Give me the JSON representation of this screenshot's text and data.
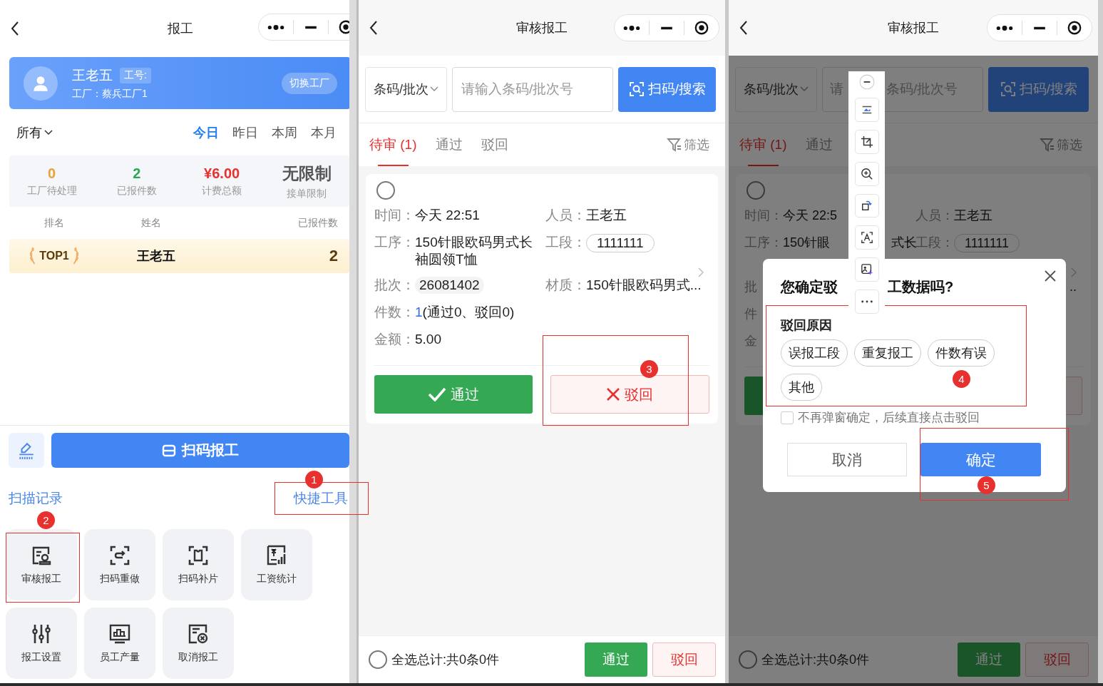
{
  "screen_report": {
    "nav": {
      "title": "报工"
    },
    "user": {
      "name": "王老五",
      "id_label": "工号:",
      "factory": "工厂：蔡兵工厂1",
      "switch_button": "切换工厂"
    },
    "scope_dropdown": "所有",
    "periods": [
      {
        "label": "今日",
        "selected": true
      },
      {
        "label": "昨日",
        "selected": false
      },
      {
        "label": "本周",
        "selected": false
      },
      {
        "label": "本月",
        "selected": false
      }
    ],
    "stats": [
      {
        "value": "0",
        "label": "工厂待处理",
        "color": "#e8a23a"
      },
      {
        "value": "2",
        "label": "已报件数",
        "color": "#2ea54f"
      },
      {
        "value": "¥6.00",
        "label": "计费总额",
        "color": "#e8302f"
      },
      {
        "value": "无限制",
        "label": "接单限制",
        "color": "#555555"
      }
    ],
    "ranking": {
      "columns": [
        "排名",
        "姓名",
        "已报件数"
      ],
      "rows": [
        {
          "rank": "TOP1",
          "name": "王老五",
          "count": "2"
        }
      ]
    },
    "scan_button": "扫码报工",
    "records_link": "扫描记录",
    "tools_link": "快捷工具",
    "tools": [
      {
        "kind": "review",
        "label": "审核报工"
      },
      {
        "kind": "redo",
        "label": "扫码重做"
      },
      {
        "kind": "patch",
        "label": "扫码补片"
      },
      {
        "kind": "salary",
        "label": "工资统计"
      },
      {
        "kind": "settings",
        "label": "报工设置"
      },
      {
        "kind": "output",
        "label": "员工产量"
      },
      {
        "kind": "cancel",
        "label": "取消报工"
      }
    ]
  },
  "screen_review": {
    "nav": {
      "title": "审核报工"
    },
    "search": {
      "mode": "条码/批次",
      "placeholder": "请输入条码/批次号",
      "button": "扫码/搜索"
    },
    "tabs": [
      {
        "label": "待审 (1)",
        "selected": true
      },
      {
        "label": "通过",
        "selected": false
      },
      {
        "label": "驳回",
        "selected": false
      }
    ],
    "filter": "筛选",
    "record": {
      "selected": false,
      "time_label": "时间：",
      "time": "今天 22:51",
      "person_label": "人员：",
      "person": "王老五",
      "process_label": "工序：",
      "process": "150针眼欧码男式长袖圆领T恤",
      "section_label": "工段：",
      "section": "1111111",
      "batch_label": "批次：",
      "batch": "26081402",
      "material_label": "材质：",
      "material": "150针眼欧码男式...",
      "count_label": "件数：",
      "count": "1",
      "count_detail": "(通过0、驳回0)",
      "amount_label": "金额：",
      "amount": "5.00",
      "pass_button": "通过",
      "reject_button": "驳回"
    },
    "footer": {
      "checked": false,
      "select_all": "全选总计:共0条0件",
      "pass_button": "通过",
      "reject_button": "驳回"
    }
  },
  "screen_reject": {
    "nav": {
      "title": "审核报工"
    },
    "search": {
      "mode": "条码/批次",
      "placeholder_parts": [
        "请",
        "条码/批次号"
      ],
      "button": "扫码/搜索"
    },
    "tabs": [
      {
        "label": "待审 (1)",
        "selected": true
      },
      {
        "label": "通过",
        "selected": false
      }
    ],
    "filter": "筛选",
    "record": {
      "selected": false,
      "time_label": "时间：",
      "time": "今天 22:5",
      "person_label": "人员：",
      "person": "王老五",
      "process_label": "工序：",
      "process_parts": [
        "150针眼",
        "式长"
      ],
      "section_label": "工段：",
      "section": "1111111",
      "row_labels": [
        "批",
        "件",
        "金"
      ],
      "material_tail": ".."
    },
    "footer": {
      "checked": false,
      "select_all": "全选总计:共0条0件",
      "pass_button": "通过",
      "reject_button": "驳回"
    },
    "dialog": {
      "title_parts": [
        "您确定驳",
        "工数据吗?"
      ],
      "reason_title": "驳回原因",
      "reasons": [
        {
          "label": "误报工段",
          "selected": false
        },
        {
          "label": "重复报工",
          "selected": false
        },
        {
          "label": "件数有误",
          "selected": false
        },
        {
          "label": "其他",
          "selected": false
        }
      ],
      "dont_ask": {
        "label": "不再弹窗确定，后续直接点击驳回",
        "checked": false
      },
      "cancel": "取消",
      "confirm": "确定"
    }
  },
  "annotations": [
    {
      "number": "1"
    },
    {
      "number": "2"
    },
    {
      "number": "3"
    },
    {
      "number": "4"
    },
    {
      "number": "5"
    }
  ]
}
